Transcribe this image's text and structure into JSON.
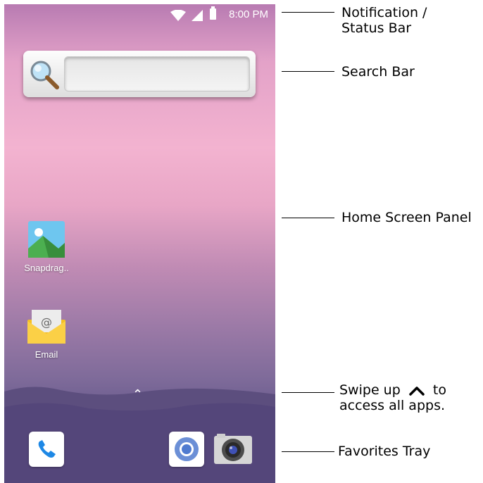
{
  "status_bar": {
    "time": "8:00 PM",
    "icons": [
      "wifi-icon",
      "signal-icon",
      "battery-icon"
    ]
  },
  "search_bar": {
    "icon": "search-icon",
    "value": ""
  },
  "apps": [
    {
      "label": "Snapdrag..",
      "icon": "gallery-icon"
    },
    {
      "label": "Email",
      "icon": "email-icon"
    }
  ],
  "favorites": [
    "phone-icon",
    "chrome-icon",
    "camera-icon"
  ],
  "callouts": {
    "status_line1": "Notification /",
    "status_line2": "Status Bar",
    "search": "Search Bar",
    "home": "Home Screen Panel",
    "swipe_part1": "Swipe up",
    "swipe_part2": "to",
    "swipe_line2": "access all apps.",
    "favorites": "Favorites Tray"
  },
  "colors": {
    "accent_phone": "#1e88e5",
    "wallpaper_top": "#b87bb2",
    "wallpaper_bottom": "#5d507f"
  }
}
